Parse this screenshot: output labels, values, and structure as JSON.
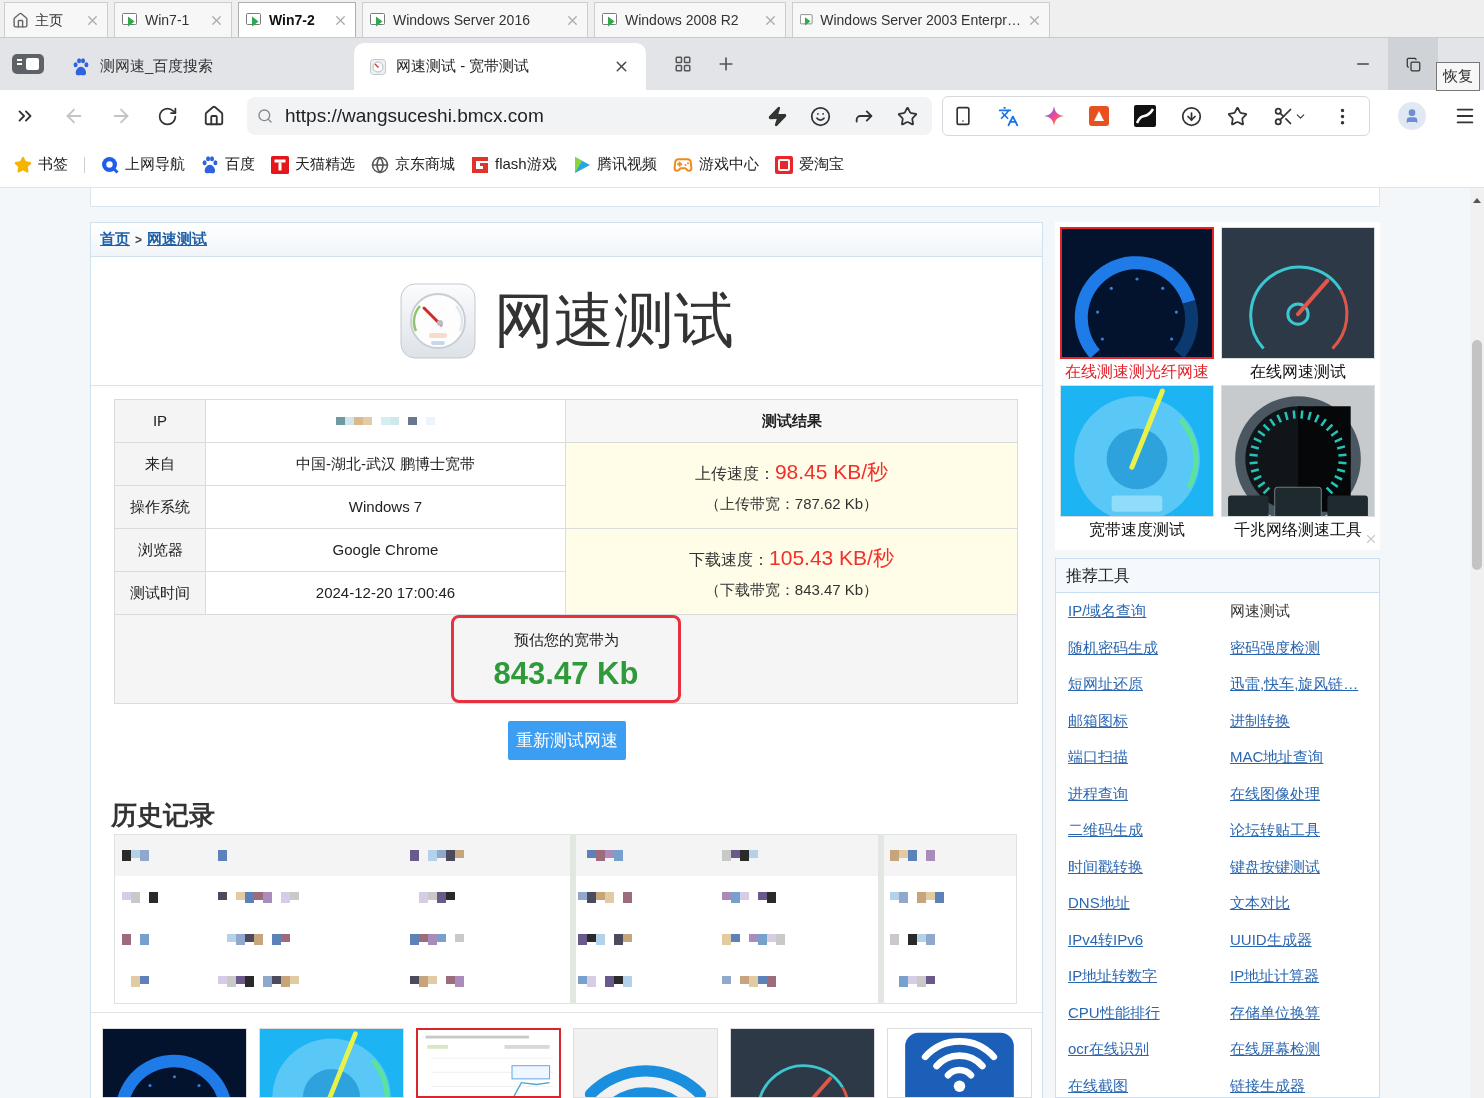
{
  "vm_tabs": [
    {
      "label": "主页",
      "kind": "home",
      "selected": false
    },
    {
      "label": "Win7-1",
      "kind": "vm",
      "selected": false
    },
    {
      "label": "Win7-2",
      "kind": "vm",
      "selected": true
    },
    {
      "label": "Windows Server 2016",
      "kind": "vm",
      "selected": false
    },
    {
      "label": "Windows 2008 R2",
      "kind": "vm",
      "selected": false
    },
    {
      "label": "Windows Server 2003 Enterpr…",
      "kind": "vm",
      "selected": false
    }
  ],
  "browser_tabs": [
    {
      "title": "测网速_百度搜索",
      "kind": "search",
      "selected": false
    },
    {
      "title": "网速测试 - 宽带测试",
      "kind": "site",
      "selected": true
    }
  ],
  "window_tooltip": "恢复",
  "address_bar": {
    "url": "https://wangsuceshi.bmcx.com",
    "back_disabled": true,
    "forward_disabled": true
  },
  "bookmarks": [
    {
      "label": "书签",
      "kind": "star"
    },
    {
      "label": "上网导航",
      "kind": "nav"
    },
    {
      "label": "百度",
      "kind": "paw"
    },
    {
      "label": "天猫精选",
      "kind": "tmall"
    },
    {
      "label": "京东商城",
      "kind": "globe"
    },
    {
      "label": "flash游戏",
      "kind": "flash"
    },
    {
      "label": "腾讯视频",
      "kind": "video"
    },
    {
      "label": "游戏中心",
      "kind": "game"
    },
    {
      "label": "爱淘宝",
      "kind": "taobao"
    }
  ],
  "breadcrumb": {
    "items": [
      "首页",
      "网速测试"
    ],
    "separator": ">"
  },
  "page_title": "网速测试",
  "info_table": {
    "rows": [
      {
        "label": "IP",
        "redacted": true
      },
      {
        "label": "来自",
        "value": "中国-湖北-武汉 鹏博士宽带",
        "redacted": false
      },
      {
        "label": "操作系统",
        "value": "Windows 7",
        "redacted": false
      },
      {
        "label": "浏览器",
        "value": "Google Chrome",
        "redacted": false
      },
      {
        "label": "测试时间",
        "value": "2024-12-20 17:00:46",
        "redacted": false
      }
    ]
  },
  "results_header": "测试结果",
  "results": [
    {
      "label": "上传速度：",
      "speed": "98.45 KB/秒",
      "bandwidth": "（上传带宽：787.62 Kb）"
    },
    {
      "label": "下载速度：",
      "speed": "105.43 KB/秒",
      "bandwidth": "（下载带宽：843.47 Kb）"
    }
  ],
  "estimate": {
    "label": "预估您的宽带为",
    "value": "843.47 Kb"
  },
  "retest_button": "重新测试网速",
  "history": {
    "title": "历史记录"
  },
  "thumbnails": [
    {
      "kind": "gauge-dark",
      "highlighted": false
    },
    {
      "kind": "gauge-blue",
      "highlighted": false
    },
    {
      "kind": "chart",
      "highlighted": true
    },
    {
      "kind": "wifi",
      "highlighted": false
    },
    {
      "kind": "gauge-slate",
      "highlighted": false
    },
    {
      "kind": "free-wifi",
      "highlighted": false
    }
  ],
  "ads": [
    {
      "caption": "在线测速测光纤网速",
      "kind": "gauge-dark",
      "highlighted": true
    },
    {
      "caption": "在线网速测试",
      "kind": "gauge-slate",
      "highlighted": false
    },
    {
      "caption": "宽带速度测试",
      "kind": "gauge-blue",
      "highlighted": false
    },
    {
      "caption": "千兆网络测速工具",
      "kind": "gauge-metal",
      "highlighted": false
    }
  ],
  "tools": {
    "title": "推荐工具",
    "items": [
      {
        "label": "IP/域名查询",
        "selected": false
      },
      {
        "label": "网速测试",
        "selected": true
      },
      {
        "label": "随机密码生成",
        "selected": false
      },
      {
        "label": "密码强度检测",
        "selected": false
      },
      {
        "label": "短网址还原",
        "selected": false
      },
      {
        "label": "迅雷,快车,旋风链…",
        "selected": false
      },
      {
        "label": "邮箱图标",
        "selected": false
      },
      {
        "label": "进制转换",
        "selected": false
      },
      {
        "label": "端口扫描",
        "selected": false
      },
      {
        "label": "MAC地址查询",
        "selected": false
      },
      {
        "label": "进程查询",
        "selected": false
      },
      {
        "label": "在线图像处理",
        "selected": false
      },
      {
        "label": "二维码生成",
        "selected": false
      },
      {
        "label": "论坛转贴工具",
        "selected": false
      },
      {
        "label": "时间戳转换",
        "selected": false
      },
      {
        "label": "键盘按键测试",
        "selected": false
      },
      {
        "label": "DNS地址",
        "selected": false
      },
      {
        "label": "文本对比",
        "selected": false
      },
      {
        "label": "IPv4转IPv6",
        "selected": false
      },
      {
        "label": "UUID生成器",
        "selected": false
      },
      {
        "label": "IP地址转数字",
        "selected": false
      },
      {
        "label": "IP地址计算器",
        "selected": false
      },
      {
        "label": "CPU性能排行",
        "selected": false
      },
      {
        "label": "存储单位换算",
        "selected": false
      },
      {
        "label": "ocr在线识别",
        "selected": false
      },
      {
        "label": "在线屏幕检测",
        "selected": false
      },
      {
        "label": "在线截图",
        "selected": false
      },
      {
        "label": "链接生成器",
        "selected": false
      }
    ]
  }
}
